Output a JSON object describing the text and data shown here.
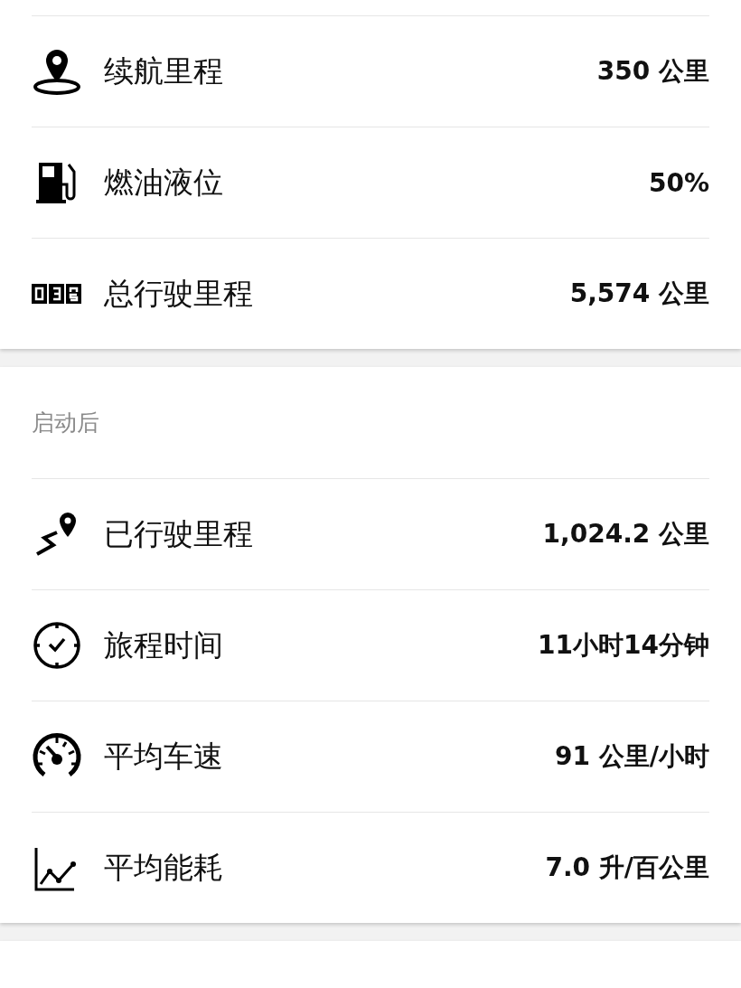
{
  "sections": [
    {
      "rows": [
        {
          "kind": "pin",
          "label": "续航里程",
          "value": "350 公里"
        },
        {
          "kind": "fuel",
          "label": "燃油液位",
          "value": "50%"
        },
        {
          "kind": "odometer",
          "label": "总行驶里程",
          "value": "5,574 公里"
        }
      ]
    },
    {
      "header": "启动后",
      "rows": [
        {
          "kind": "route",
          "label": "已行驶里程",
          "value": "1,024.2 公里"
        },
        {
          "kind": "clock",
          "label": "旅程时间",
          "value": "11小时14分钟"
        },
        {
          "kind": "speed",
          "label": "平均车速",
          "value": "91 公里/小时"
        },
        {
          "kind": "chart",
          "label": "平均能耗",
          "value": "7.0 升/百公里"
        }
      ]
    },
    {
      "kind": "card"
    }
  ]
}
